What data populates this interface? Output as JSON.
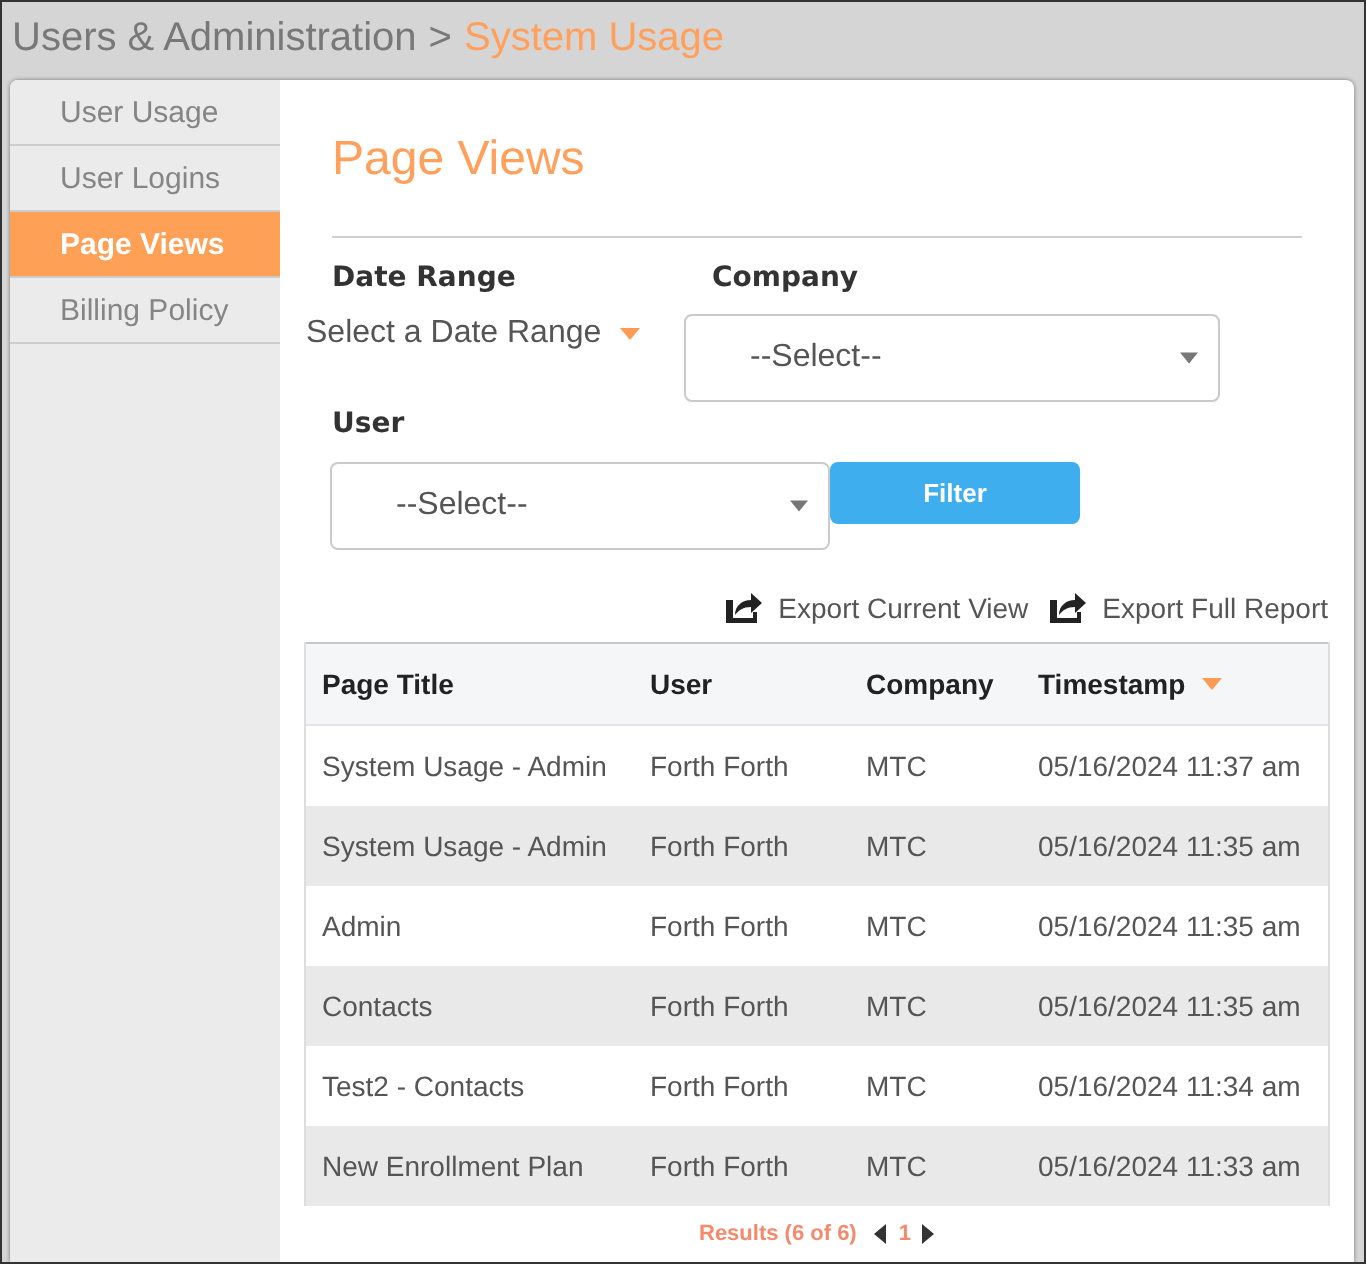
{
  "breadcrumb": {
    "parent": "Users & Administration",
    "separator": ">",
    "current": "System Usage"
  },
  "sidebar": {
    "items": [
      {
        "label": "User Usage",
        "selected": false
      },
      {
        "label": "User Logins",
        "selected": false
      },
      {
        "label": "Page Views",
        "selected": true
      },
      {
        "label": "Billing Policy",
        "selected": false
      }
    ]
  },
  "page_title": "Page Views",
  "filters": {
    "date_range": {
      "label": "Date Range",
      "value": "Select a Date Range"
    },
    "company": {
      "label": "Company",
      "value": "--Select--"
    },
    "user": {
      "label": "User",
      "value": "--Select--"
    },
    "filter_button": "Filter"
  },
  "export_links": [
    "Export Current View",
    "Export Full Report"
  ],
  "table": {
    "columns": [
      {
        "label": "Page Title",
        "sorted": false
      },
      {
        "label": "User",
        "sorted": false
      },
      {
        "label": "Company",
        "sorted": false
      },
      {
        "label": "Timestamp",
        "sorted": true
      }
    ],
    "rows": [
      [
        "System Usage - Admin",
        "Forth Forth",
        "MTC",
        "05/16/2024 11:37 am"
      ],
      [
        "System Usage - Admin",
        "Forth Forth",
        "MTC",
        "05/16/2024 11:35 am"
      ],
      [
        "Admin",
        "Forth Forth",
        "MTC",
        "05/16/2024 11:35 am"
      ],
      [
        "Contacts",
        "Forth Forth",
        "MTC",
        "05/16/2024 11:35 am"
      ],
      [
        "Test2 - Contacts",
        "Forth Forth",
        "MTC",
        "05/16/2024 11:34 am"
      ],
      [
        "New Enrollment Plan",
        "Forth Forth",
        "MTC",
        "05/16/2024 11:33 am"
      ]
    ]
  },
  "pagination": {
    "results": "Results (6 of 6)",
    "pages": [
      {
        "label": "1",
        "selected": true
      }
    ]
  }
}
